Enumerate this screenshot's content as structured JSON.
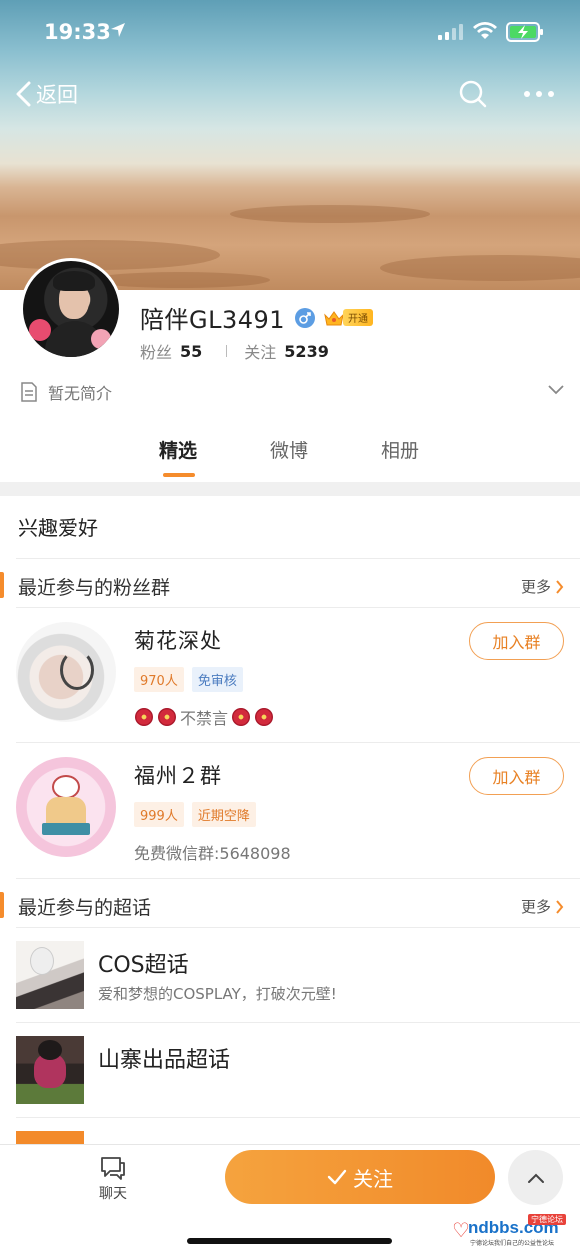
{
  "status_bar": {
    "time": "19:33"
  },
  "nav": {
    "back_label": "返回"
  },
  "profile": {
    "username": "陪伴GL3491",
    "vip_label": "开通",
    "fans_label": "粉丝",
    "fans_count": "55",
    "following_label": "关注",
    "following_count": "5239",
    "bio": "暂无简介"
  },
  "tabs": [
    {
      "label": "精选",
      "active": true
    },
    {
      "label": "微博",
      "active": false
    },
    {
      "label": "相册",
      "active": false
    }
  ],
  "interests_title": "兴趣爱好",
  "fan_groups": {
    "title": "最近参与的粉丝群",
    "more_label": "更多",
    "items": [
      {
        "name": "菊花深处",
        "join_label": "加入群",
        "tags": [
          "970人",
          "免审核"
        ],
        "desc": "不禁言"
      },
      {
        "name": "福州２群",
        "join_label": "加入群",
        "tags": [
          "999人",
          "近期空降"
        ],
        "desc": "免费微信群:5648098"
      }
    ]
  },
  "super_topics": {
    "title": "最近参与的超话",
    "more_label": "更多",
    "items": [
      {
        "name": "COS超话",
        "desc": "爱和梦想的COSPLAY，打破次元壁!"
      },
      {
        "name": "山寨出品超话",
        "desc": ""
      }
    ]
  },
  "bottom_bar": {
    "chat_label": "聊天",
    "follow_label": "关注"
  },
  "watermark": {
    "site": "ndbbs.com",
    "badge": "宁德论坛",
    "tagline": "宁德论坛我们自己的公益性论坛"
  },
  "colors": {
    "accent": "#f58c2c",
    "follow_button": "#f18a2a",
    "tag_orange_text": "#e07a2a",
    "tag_blue_text": "#4b7cc0",
    "gender_blue": "#5c9de3"
  }
}
